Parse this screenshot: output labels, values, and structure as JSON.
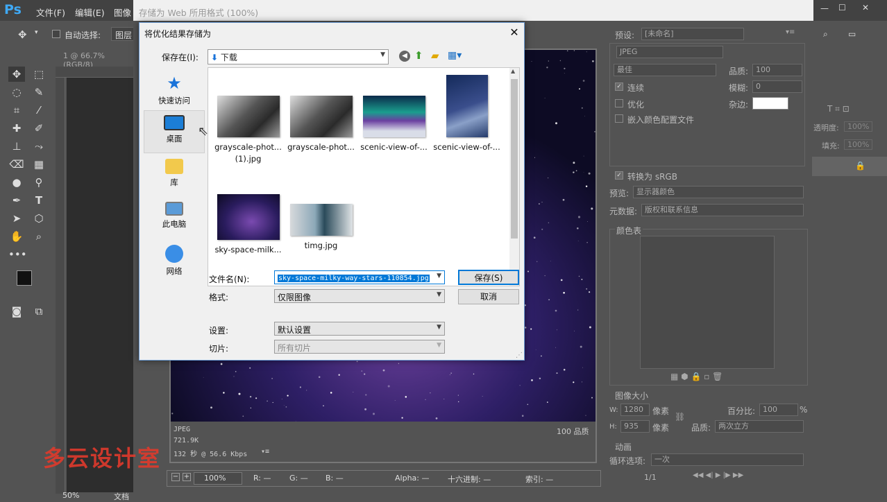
{
  "app": {
    "logo": "Ps",
    "menus": [
      "文件(F)",
      "编辑(E)",
      "图像"
    ],
    "options_bar": {
      "auto_select_label": "自动选择:",
      "layer_dropdown": "图层"
    },
    "doc_tab": "1 @ 66.7%(RGB/8)",
    "status_zoom": "50%",
    "status_doc": "文档"
  },
  "save_for_web": {
    "title": "存储为 Web 所用格式 (100%)",
    "preview_info": {
      "format": "JPEG",
      "size": "721.9K",
      "time": "132 秒 @ 56.6 Kbps",
      "quality": "100 品质"
    },
    "bottom_bar": {
      "zoom": "100%",
      "r": "R: —",
      "g": "G: —",
      "b": "B: —",
      "alpha": "Alpha: —",
      "hex": "十六进制: —",
      "index": "索引: —"
    },
    "right": {
      "preset_label": "预设:",
      "preset_value": "[未命名]",
      "format": "JPEG",
      "quality_preset": "最佳",
      "quality_label": "品质:",
      "quality_value": "100",
      "progressive": "连续",
      "blur_label": "模糊:",
      "blur_value": "0",
      "optimized": "优化",
      "matte_label": "杂边:",
      "embed_profile": "嵌入颜色配置文件",
      "convert_srgb": "转换为 sRGB",
      "preview_label": "预览:",
      "preview_value": "显示器颜色",
      "metadata_label": "元数据:",
      "metadata_value": "版权和联系信息",
      "color_table": "颜色表",
      "image_size": "图像大小",
      "w_label": "W:",
      "w_value": "1280",
      "h_label": "H:",
      "h_value": "935",
      "px": "像素",
      "percent_label": "百分比:",
      "percent_value": "100",
      "percent_sign": "%",
      "resample_label": "品质:",
      "resample_value": "两次立方",
      "animation": "动画",
      "loop_label": "循环选项:",
      "loop_value": "一次",
      "frame": "1/1"
    }
  },
  "far_right": {
    "opacity_label": "透明度:",
    "opacity_value": "100%",
    "fill_label": "填充:",
    "fill_value": "100%"
  },
  "dialog": {
    "title": "将优化结果存储为",
    "save_in_label": "保存在(I):",
    "save_in_value": "下载",
    "places": [
      "快速访问",
      "桌面",
      "库",
      "此电脑",
      "网络"
    ],
    "files": [
      {
        "name": "grayscale-phot...",
        "name2": "(1).jpg"
      },
      {
        "name": "grayscale-phot...",
        "name2": ""
      },
      {
        "name": "scenic-view-of-...",
        "name2": ""
      },
      {
        "name": "scenic-view-of-...",
        "name2": ""
      },
      {
        "name": "sky-space-milk...",
        "name2": ""
      },
      {
        "name": "timg.jpg",
        "name2": ""
      }
    ],
    "filename_label": "文件名(N):",
    "filename_value": "sky-space-milky-way-stars-110854.jpg",
    "format_label": "格式:",
    "format_value": "仅限图像",
    "settings_label": "设置:",
    "settings_value": "默认设置",
    "slices_label": "切片:",
    "slices_value": "所有切片",
    "save_button": "保存(S)",
    "cancel_button": "取消"
  },
  "watermark": "多云设计室",
  "colors": {
    "ps_bg": "#535353",
    "dialog_bg": "#f0f0f0",
    "accent": "#0078d7",
    "watermark": "#e03a2c"
  }
}
